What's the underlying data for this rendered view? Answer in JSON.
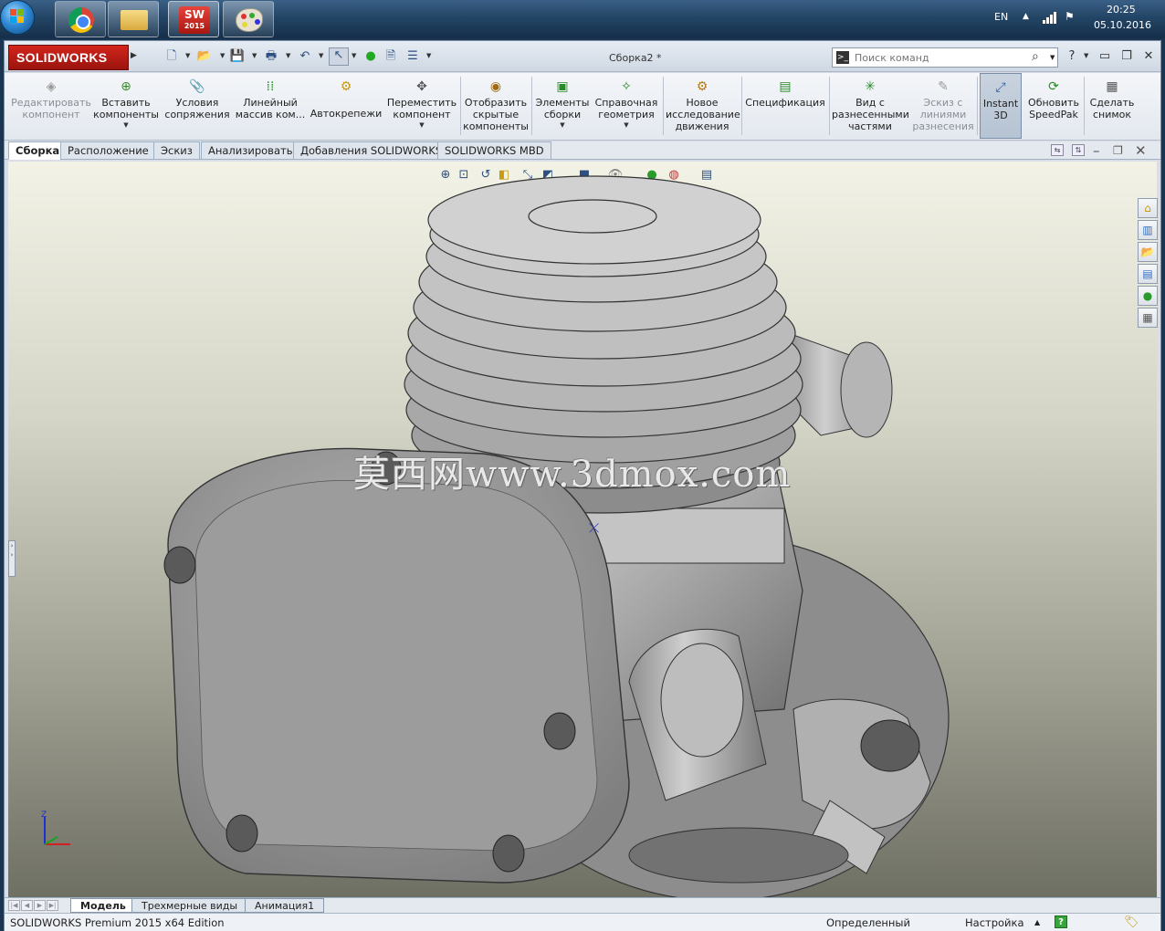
{
  "taskbar": {
    "tray_lang": "EN",
    "time": "20:25",
    "date": "05.10.2016",
    "sw_icon_text": "SW",
    "sw_icon_year": "2015"
  },
  "app": {
    "brand": "SOLIDWORKS",
    "doc_title": "Сборка2 *",
    "search_placeholder": "Поиск команд"
  },
  "ribbon": {
    "items": [
      {
        "label1": "Редактировать",
        "label2": "компонент",
        "icon": "edit-component-icon"
      },
      {
        "label1": "Вставить",
        "label2": "компоненты",
        "icon": "insert-components-icon"
      },
      {
        "label1": "Условия",
        "label2": "сопряжения",
        "icon": "mate-icon"
      },
      {
        "label1": "Линейный",
        "label2": "массив ком...",
        "icon": "linear-pattern-icon"
      },
      {
        "label1": "Автокрепежи",
        "icon": "smart-fasteners-icon"
      },
      {
        "label1": "Переместить",
        "label2": "компонент",
        "icon": "move-component-icon"
      },
      {
        "label1": "Отобразить",
        "label2": "скрытые",
        "label3": "компоненты",
        "icon": "show-hidden-icon"
      },
      {
        "label1": "Элементы",
        "label2": "сборки",
        "icon": "assembly-features-icon"
      },
      {
        "label1": "Справочная",
        "label2": "геометрия",
        "icon": "reference-geometry-icon"
      },
      {
        "label1": "Новое",
        "label2": "исследование",
        "label3": "движения",
        "icon": "motion-study-icon"
      },
      {
        "label1": "Спецификация",
        "icon": "bom-icon"
      },
      {
        "label1": "Вид с",
        "label2": "разнесенными",
        "label3": "частями",
        "icon": "exploded-view-icon"
      },
      {
        "label1": "Эскиз с",
        "label2": "линиями",
        "label3": "разнесения",
        "icon": "explode-line-sketch-icon"
      },
      {
        "label1": "Instant",
        "label2": "3D",
        "icon": "instant3d-icon"
      },
      {
        "label1": "Обновить",
        "label2": "SpeedPak",
        "icon": "speedpak-icon"
      },
      {
        "label1": "Сделать",
        "label2": "снимок",
        "icon": "snapshot-icon"
      }
    ]
  },
  "tabs": [
    "Сборка",
    "Расположение",
    "Эскиз",
    "Анализировать",
    "Добавления SOLIDWORKS",
    "SOLIDWORKS MBD"
  ],
  "viewport": {
    "watermark": "莫西网www.3dmox.com",
    "triad_z": "Z"
  },
  "bottom_tabs": [
    "Модель",
    "Трехмерные виды",
    "Анимация1"
  ],
  "status": {
    "edition": "SOLIDWORKS Premium 2015 x64 Edition",
    "state": "Определенный",
    "units": "Настройка"
  },
  "colors": {
    "brand_red": "#c8201a",
    "model_gray": "#9a9a9a"
  }
}
